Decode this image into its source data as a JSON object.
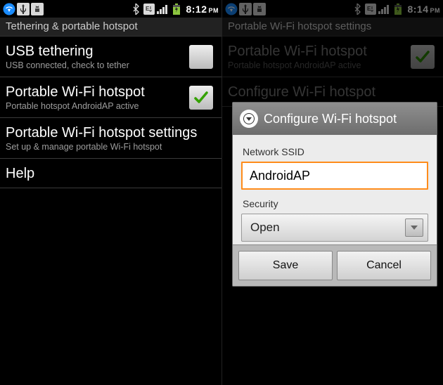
{
  "left": {
    "status": {
      "time": "8:12",
      "ampm": "PM"
    },
    "header": "Tethering & portable hotspot",
    "items": [
      {
        "title": "USB tethering",
        "sub": "USB connected, check to tether",
        "checkable": true,
        "checked": false
      },
      {
        "title": "Portable Wi-Fi hotspot",
        "sub": "Portable hotspot AndroidAP active",
        "checkable": true,
        "checked": true
      },
      {
        "title": "Portable Wi-Fi hotspot settings",
        "sub": "Set up & manage portable Wi-Fi hotspot",
        "checkable": false
      },
      {
        "title": "Help",
        "sub": "",
        "checkable": false
      }
    ]
  },
  "right": {
    "status": {
      "time": "8:14",
      "ampm": "PM"
    },
    "header": "Portable Wi-Fi hotspot settings",
    "items": [
      {
        "title": "Portable Wi-Fi hotspot",
        "sub": "Portable hotspot AndroidAP active",
        "checkable": true,
        "checked": true
      },
      {
        "title": "Configure Wi-Fi hotspot",
        "sub": "",
        "checkable": false
      }
    ],
    "dialog": {
      "title": "Configure Wi-Fi hotspot",
      "ssid_label": "Network SSID",
      "ssid_value": "AndroidAP",
      "security_label": "Security",
      "security_value": "Open",
      "save": "Save",
      "cancel": "Cancel"
    }
  }
}
